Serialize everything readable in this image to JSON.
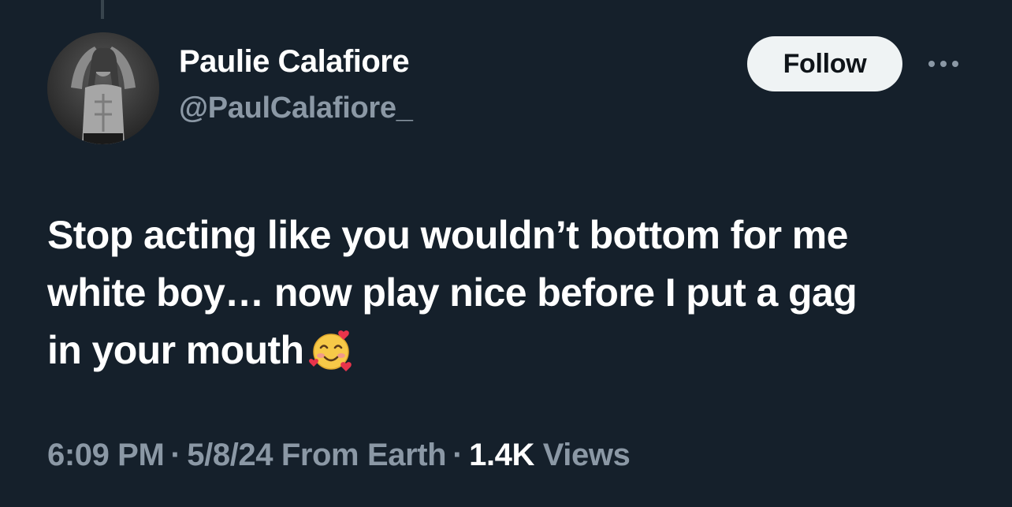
{
  "author": {
    "display_name": "Paulie Calafiore",
    "handle": "@PaulCalafiore_",
    "avatar_icon": "profile-photo"
  },
  "actions": {
    "follow_label": "Follow",
    "more_icon": "ellipsis-icon"
  },
  "tweet": {
    "line1": "Stop acting like you wouldn’t bottom for me",
    "line2": "white boy… now play nice before I put a gag",
    "line3": "in your mouth",
    "emoji": "smiling-face-with-hearts"
  },
  "meta": {
    "time": "6:09 PM",
    "separator": "·",
    "date": "5/8/24",
    "source": "From Earth",
    "views_count": "1.4K",
    "views_label": "Views"
  },
  "colors": {
    "background": "#15202b",
    "secondary_text": "#8b98a5",
    "follow_button_bg": "#eff3f4"
  }
}
